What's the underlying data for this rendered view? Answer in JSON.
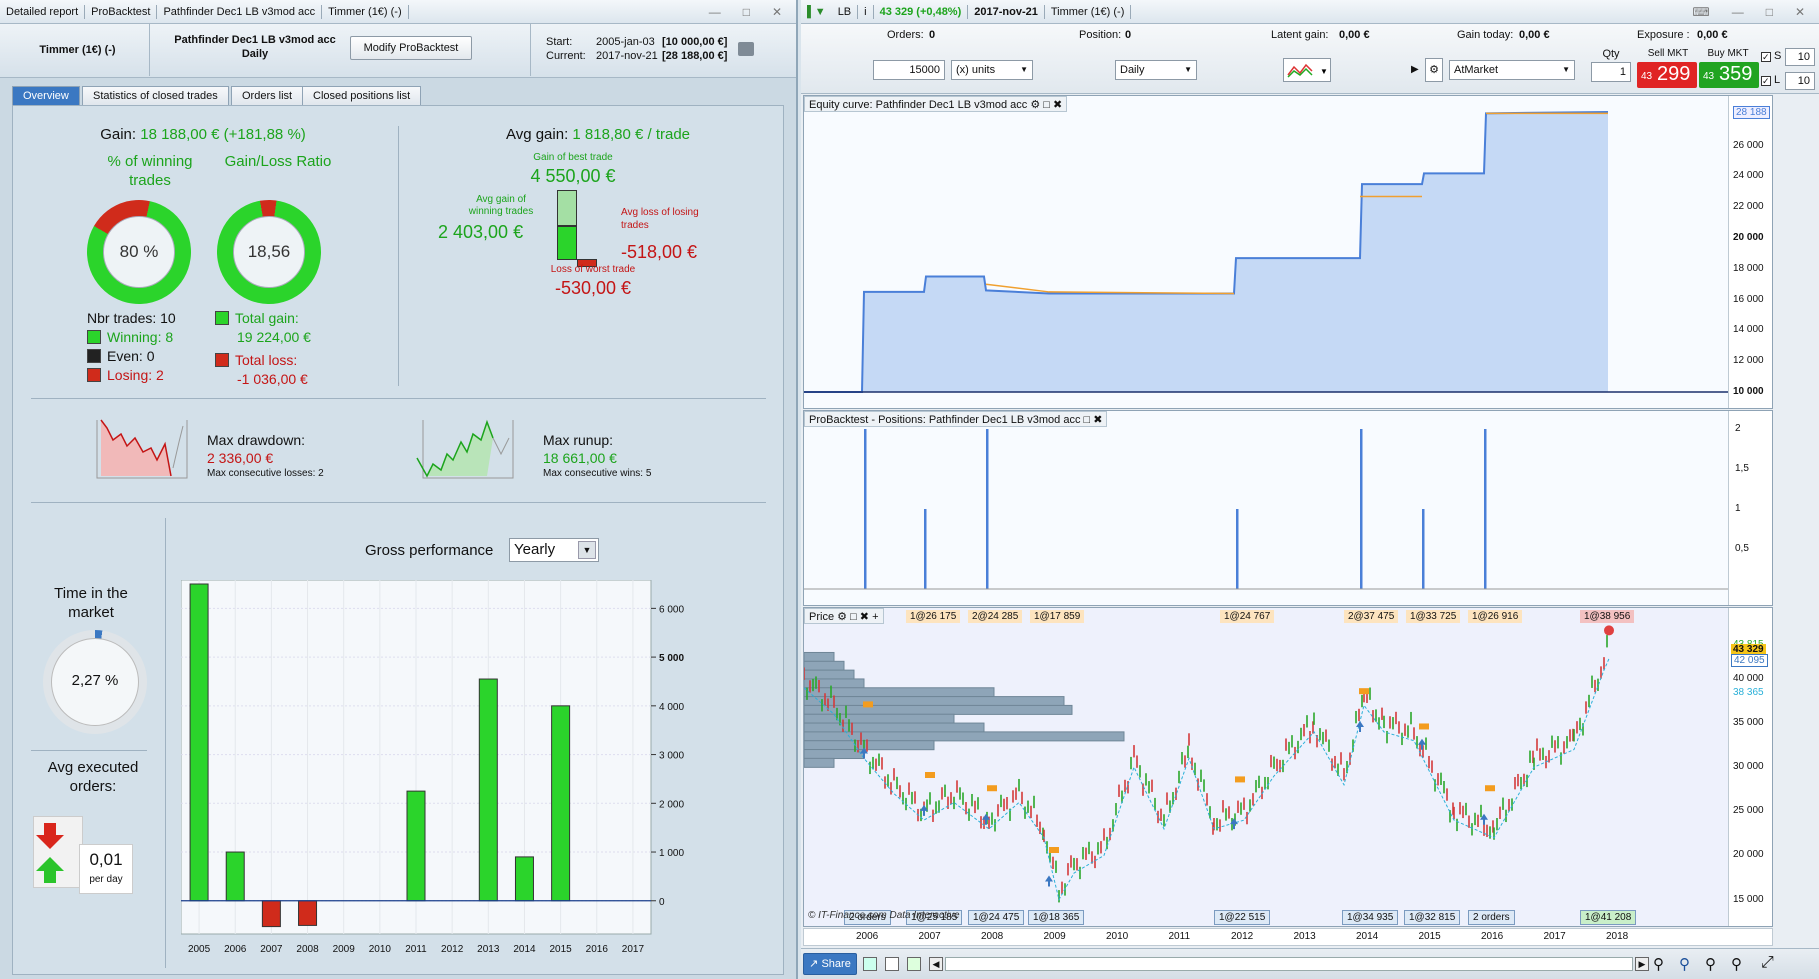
{
  "left_window": {
    "tabs_title": [
      "Detailed report",
      "ProBacktest",
      "Pathfinder Dec1 LB v3mod acc",
      "Timmer (1€) (-)"
    ]
  },
  "header": {
    "instrument": "Timmer (1€) (-)",
    "strategy": "Pathfinder Dec1 LB v3mod acc",
    "period": "Daily",
    "modify_label": "Modify ProBacktest",
    "start_label": "Start:",
    "start_date": "2005-jan-03",
    "start_value": "[10 000,00 €]",
    "current_label": "Current:",
    "current_date": "2017-nov-21",
    "current_value": "[28 188,00 €]"
  },
  "tabs": [
    "Overview",
    "Statistics of closed trades",
    "Orders list",
    "Closed positions list"
  ],
  "overview": {
    "gain_label": "Gain:",
    "gain_value": "18 188,00 € (+181,88 %)",
    "winning_pct_title": "% of winning trades",
    "winning_pct": "80 %",
    "winning_fraction": 0.8,
    "gainloss_title": "Gain/Loss Ratio",
    "gainloss": "18,56",
    "gainloss_fraction": 0.949,
    "nbr_trades": "Nbr trades: 10",
    "winning": "Winning: 8",
    "even": "Even: 0",
    "losing": "Losing: 2",
    "total_gain_label": "Total gain:",
    "total_gain": "19 224,00 €",
    "total_loss_label": "Total loss:",
    "total_loss": "-1 036,00 €",
    "avg_gain_label": "Avg gain:",
    "avg_gain": "1 818,80 € / trade",
    "best_label": "Gain of best trade",
    "best": "4 550,00 €",
    "avg_win_label": "Avg gain of winning trades",
    "avg_win": "2 403,00 €",
    "avg_loss_label": "Avg loss of losing trades",
    "avg_loss": "-518,00 €",
    "worst_label": "Loss of worst trade",
    "worst": "-530,00 €",
    "max_dd_label": "Max drawdown:",
    "max_dd": "2 336,00 €",
    "max_cons_loss": "Max consecutive losses: 2",
    "max_ru_label": "Max runup:",
    "max_ru": "18 661,00 €",
    "max_cons_win": "Max consecutive wins: 5",
    "time_market_title": "Time in the market",
    "time_market": "2,27 %",
    "time_market_fraction": 0.0227,
    "avg_exec_title": "Avg executed orders:",
    "avg_exec": "0,01",
    "per_day": "per day",
    "gross_title": "Gross performance",
    "gross_select": "Yearly"
  },
  "chart_data": [
    {
      "type": "bar",
      "title": "Gross performance",
      "categories": [
        "2005",
        "2006",
        "2007",
        "2008",
        "2009",
        "2010",
        "2011",
        "2012",
        "2013",
        "2014",
        "2015",
        "2016",
        "2017"
      ],
      "values": [
        6500,
        1000,
        -530,
        -506,
        0,
        0,
        2250,
        0,
        4550,
        900,
        4000,
        0,
        0
      ],
      "ylim": [
        -1000,
        6500
      ],
      "yticks": [
        "6 000",
        "5 000",
        "4 000",
        "3 000",
        "2 000",
        "1 000",
        "0"
      ]
    },
    {
      "type": "line",
      "title": "Equity curve: Pathfinder Dec1 LB v3mod acc",
      "x": [
        "2005",
        "2006",
        "2007",
        "2008",
        "2009",
        "2010",
        "2011",
        "2012",
        "2013",
        "2014",
        "2015",
        "2016",
        "2017"
      ],
      "y": [
        10000,
        16500,
        17500,
        16600,
        16400,
        16400,
        16400,
        18700,
        23500,
        24200,
        24200,
        28100,
        28188
      ],
      "yticks": [
        "28 188",
        "26 000",
        "24 000",
        "22 000",
        "20 000",
        "18 000",
        "16 000",
        "14 000",
        "12 000",
        "10 000"
      ]
    },
    {
      "type": "bar",
      "title": "ProBacktest - Positions: Pathfinder Dec1 LB v3mod acc",
      "yticks": [
        "2",
        "1,5",
        "1",
        "0,5"
      ]
    },
    {
      "type": "line",
      "title": "Price",
      "x": [
        "2006",
        "2007",
        "2008",
        "2009",
        "2010",
        "2011",
        "2012",
        "2013",
        "2014",
        "2015",
        "2016",
        "2017",
        "2018"
      ],
      "yticks": [
        "43 815",
        "43 329",
        "42 095",
        "40 000",
        "38 365",
        "35 000",
        "30 000",
        "25 000",
        "20 000",
        "15 000"
      ]
    }
  ],
  "right": {
    "title_symbol": "LB",
    "title_price": "43 329 (+0,48%)",
    "title_date": "2017-nov-21",
    "title_name": "Timmer (1€) (-)",
    "orders_label": "Orders:",
    "orders": "0",
    "position_label": "Position:",
    "position": "0",
    "latent_label": "Latent gain:",
    "latent": "0,00 €",
    "gain_today_label": "Gain today:",
    "gain_today": "0,00 €",
    "exposure_label": "Exposure :",
    "exposure": "0,00 €",
    "units_value": "15000",
    "units_label": "(x) units",
    "period": "Daily",
    "order_type": "AtMarket",
    "qty_label": "Qty",
    "qty": "1",
    "sell_label": "Sell MKT",
    "sell_prefix": "43",
    "sell_price": "299",
    "buy_label": "Buy MKT",
    "buy_prefix": "43",
    "buy_price": "359",
    "s_label": "S",
    "s_value": "10",
    "l_label": "L",
    "l_value": "10",
    "top_labels": [
      "1@26 175",
      "2@24 285",
      "1@17 859",
      "1@24 767",
      "2@37 475",
      "1@33 725",
      "1@26 916",
      "1@38 956"
    ],
    "bottom_labels": [
      "2 orders",
      "1@25 185",
      "1@24 475",
      "1@18 365",
      "1@22 515",
      "1@34 935",
      "1@32 815",
      "2 orders",
      "1@41 208"
    ],
    "credit": "© IT-Finance.com Data Interactive",
    "share": "Share"
  }
}
